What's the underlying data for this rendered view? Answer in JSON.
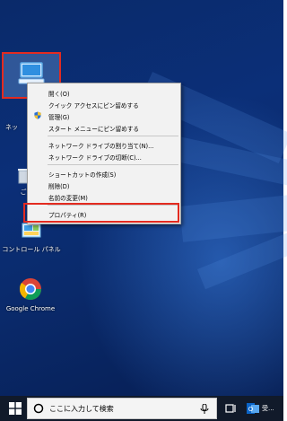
{
  "desktop": {
    "icons": [
      {
        "name": "PC",
        "label": ""
      },
      {
        "name": "network",
        "label": "ネッ"
      },
      {
        "name": "recycle-bin",
        "label": "ご"
      },
      {
        "name": "control-panel",
        "label": "コントロール パネル"
      },
      {
        "name": "chrome",
        "label": "Google Chrome"
      }
    ]
  },
  "context_menu": {
    "items": [
      {
        "label": "開く(O)"
      },
      {
        "label": "クイック アクセスにピン留めする"
      },
      {
        "label": "管理(G)",
        "icon": "shield-icon"
      },
      {
        "label": "スタート メニューにピン留めする"
      },
      {
        "label": "ネットワーク ドライブの割り当て(N)..."
      },
      {
        "label": "ネットワーク ドライブの切断(C)..."
      },
      {
        "label": "ショートカットの作成(S)"
      },
      {
        "label": "削除(D)"
      },
      {
        "label": "名前の変更(M)"
      },
      {
        "label": "プロパティ(R)"
      }
    ]
  },
  "taskbar": {
    "search_placeholder": "ここに入力して検索",
    "tray_label": "受..."
  },
  "colors": {
    "highlight_border": "#e32b20",
    "wallpaper": "#0b2f78",
    "taskbar": "#111a2a"
  }
}
